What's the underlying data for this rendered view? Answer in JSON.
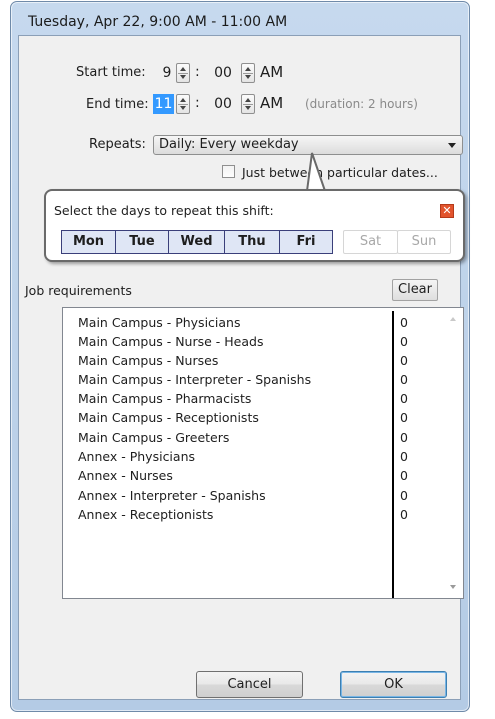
{
  "window": {
    "title": "Tuesday, Apr 22, 9:00 AM - 11:00 AM"
  },
  "start_time": {
    "label": "Start time:",
    "hour": "9",
    "sep": ":",
    "minute": "00",
    "ampm": "AM"
  },
  "end_time": {
    "label": "End time:",
    "hour": "11",
    "sep": ":",
    "minute": "00",
    "ampm": "AM",
    "duration": "(duration: 2 hours)"
  },
  "repeats": {
    "label": "Repeats:",
    "value": "Daily: Every weekday"
  },
  "between_dates": {
    "label": "Just between particular dates...",
    "checked": false
  },
  "days_popup": {
    "prompt": "Select the days to repeat this shift:",
    "close_glyph": "✕",
    "days": [
      {
        "label": "Mon",
        "selected": true
      },
      {
        "label": "Tue",
        "selected": true
      },
      {
        "label": "Wed",
        "selected": true
      },
      {
        "label": "Thu",
        "selected": true
      },
      {
        "label": "Fri",
        "selected": true
      },
      {
        "label": "Sat",
        "selected": false
      },
      {
        "label": "Sun",
        "selected": false
      }
    ]
  },
  "job_requirements": {
    "label": "Job requirements",
    "clear_label": "Clear",
    "rows": [
      {
        "name": "Main Campus - Physicians",
        "count": "0"
      },
      {
        "name": "Main Campus - Nurse - Heads",
        "count": "0"
      },
      {
        "name": "Main Campus - Nurses",
        "count": "0"
      },
      {
        "name": "Main Campus - Interpreter - Spanishs",
        "count": "0"
      },
      {
        "name": "Main Campus - Pharmacists",
        "count": "0"
      },
      {
        "name": "Main Campus - Receptionists",
        "count": "0"
      },
      {
        "name": "Main Campus - Greeters",
        "count": "0"
      },
      {
        "name": "Annex - Physicians",
        "count": "0"
      },
      {
        "name": "Annex - Nurses",
        "count": "0"
      },
      {
        "name": "Annex - Interpreter - Spanishs",
        "count": "0"
      },
      {
        "name": "Annex - Receptionists",
        "count": "0"
      }
    ]
  },
  "buttons": {
    "cancel": "Cancel",
    "ok": "OK"
  }
}
